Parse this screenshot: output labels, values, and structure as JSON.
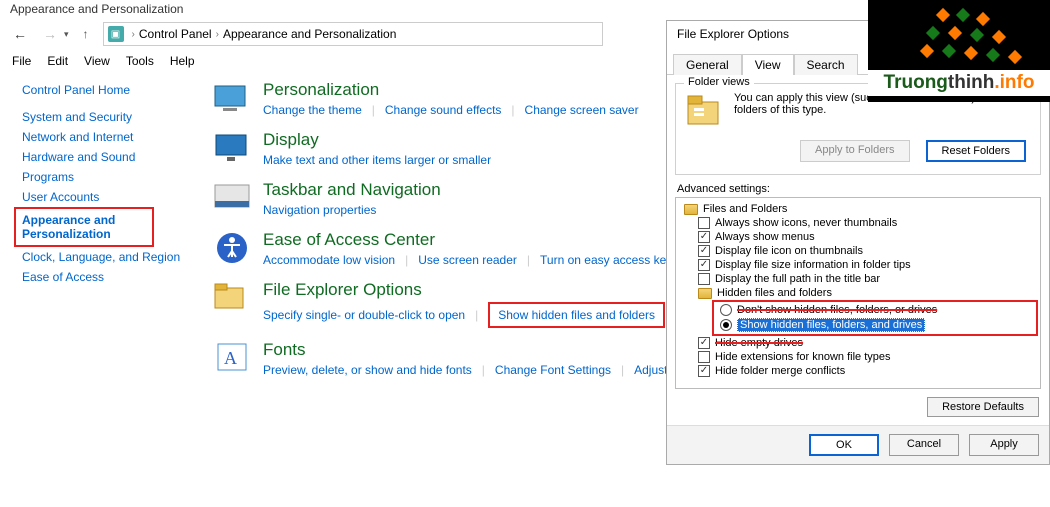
{
  "window_title": "Appearance and Personalization",
  "breadcrumb": {
    "root": "Control Panel",
    "current": "Appearance and Personalization"
  },
  "menu": {
    "file": "File",
    "edit": "Edit",
    "view": "View",
    "tools": "Tools",
    "help": "Help"
  },
  "sidebar": {
    "home": "Control Panel Home",
    "items": [
      "System and Security",
      "Network and Internet",
      "Hardware and Sound",
      "Programs",
      "User Accounts"
    ],
    "current_line1": "Appearance and",
    "current_line2": "Personalization",
    "after": [
      "Clock, Language, and Region",
      "Ease of Access"
    ]
  },
  "categories": [
    {
      "title": "Personalization",
      "links": [
        "Change the theme",
        "Change sound effects",
        "Change screen saver"
      ]
    },
    {
      "title": "Display",
      "links": [
        "Make text and other items larger or smaller"
      ]
    },
    {
      "title": "Taskbar and Navigation",
      "links": [
        "Navigation properties"
      ]
    },
    {
      "title": "Ease of Access Center",
      "links": [
        "Accommodate low vision",
        "Use screen reader",
        "Turn on easy access keys"
      ]
    },
    {
      "title": "File Explorer Options",
      "links": [
        "Specify single- or double-click to open"
      ],
      "boxed_link": "Show hidden files and folders"
    },
    {
      "title": "Fonts",
      "links": [
        "Preview, delete, or show and hide fonts",
        "Change Font Settings",
        "Adjust C"
      ]
    }
  ],
  "dialog": {
    "title": "File Explorer Options",
    "tabs": {
      "general": "General",
      "view": "View",
      "search": "Search"
    },
    "folder_views": {
      "group": "Folder views",
      "text": "You can apply this view (such as Details or Icons) to all folders of this type.",
      "apply": "Apply to Folders",
      "reset": "Reset Folders"
    },
    "advanced_label": "Advanced settings:",
    "tree": {
      "root": "Files and Folders",
      "i1": "Always show icons, never thumbnails",
      "i2": "Always show menus",
      "i3": "Display file icon on thumbnails",
      "i4": "Display file size information in folder tips",
      "i5": "Display the full path in the title bar",
      "hidden_group": "Hidden files and folders",
      "r1": "Don't show hidden files, folders, or drives",
      "r2": "Show hidden files, folders, and drives",
      "i6": "Hide empty drives",
      "i7": "Hide extensions for known file types",
      "i8": "Hide folder merge conflicts"
    },
    "restore": "Restore Defaults",
    "footer": {
      "ok": "OK",
      "cancel": "Cancel",
      "apply": "Apply"
    }
  },
  "logo": {
    "t1": "Truong",
    "t2": "thinh",
    "t3": ".",
    "t4": "info"
  }
}
